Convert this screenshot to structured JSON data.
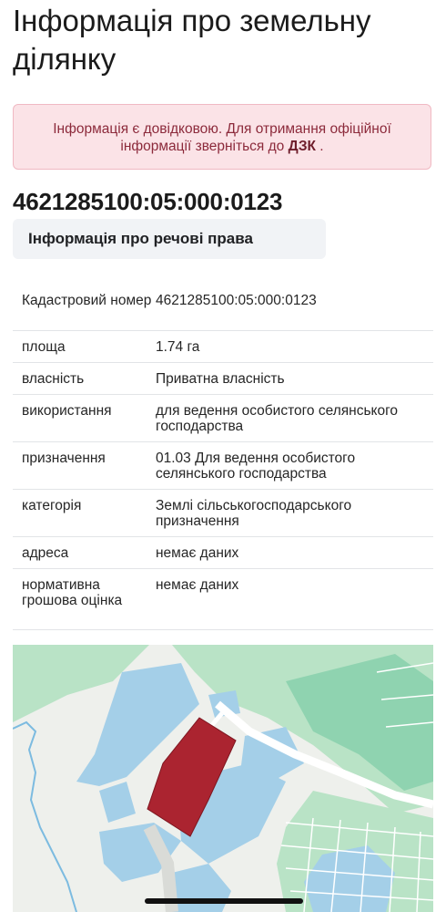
{
  "page": {
    "title": "Інформація про земельну ділянку"
  },
  "notice": {
    "text_before": "Інформація є довідковою. Для отримання офіційної інформації зверніться до ",
    "link_text": "ДЗК",
    "text_after": " ."
  },
  "parcel": {
    "cadastral_number": "4621285100:05:000:0123"
  },
  "tab": {
    "label": "Інформація про речові права"
  },
  "details": {
    "rows": [
      {
        "key": "Кадастровий номер",
        "value": "4621285100:05:000:0123"
      },
      {
        "key": "площа",
        "value": "1.74 га"
      },
      {
        "key": "власність",
        "value": "Приватна власність"
      },
      {
        "key": "використання",
        "value": "для ведення особистого селянського господарства"
      },
      {
        "key": "призначення",
        "value": "01.03 Для ведення особистого селянського господарства"
      },
      {
        "key": "категорія",
        "value": "Землі сільськогосподарського призначення"
      },
      {
        "key": "адреса",
        "value": "немає даних"
      },
      {
        "key": "нормативна грошова оцінка",
        "value": "немає даних"
      }
    ]
  },
  "map": {
    "colors": {
      "background": "#eef0ec",
      "forest": "#b9e3c6",
      "dark_forest": "#8fd3b0",
      "parcels_blue": "#a4cfe8",
      "selected_parcel": "#ab2430",
      "road": "#ffffff",
      "river": "#7cbbe0"
    }
  }
}
